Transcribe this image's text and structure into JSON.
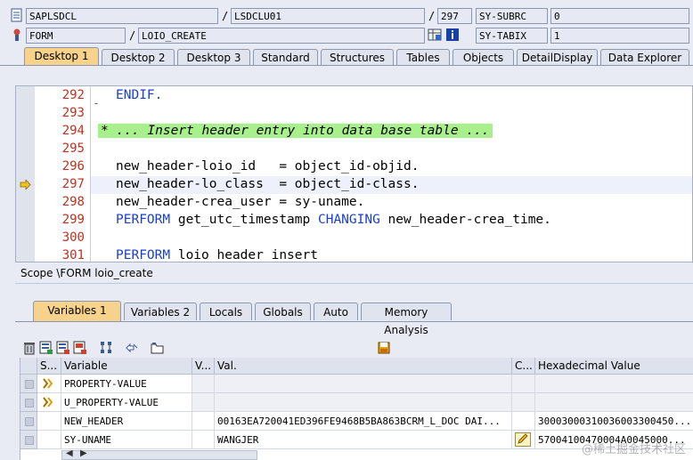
{
  "header": {
    "program": "SAPLSDCL",
    "include": "LSDCLU01",
    "line": "297",
    "sy_subrc_label": "SY-SUBRC",
    "sy_subrc_value": "0",
    "event_type": "FORM",
    "event_name": "LOIO_CREATE",
    "sy_tabix_label": "SY-TABIX",
    "sy_tabix_value": "1"
  },
  "desktop_tabs": [
    "Desktop 1",
    "Desktop 2",
    "Desktop 3",
    "Standard",
    "Structures",
    "Tables",
    "Objects",
    "DetailDisplay",
    "Data Explorer"
  ],
  "code_lines": [
    {
      "num": "292",
      "text": "ENDIF."
    },
    {
      "num": "293",
      "text": ""
    },
    {
      "num": "294",
      "text": "* ... Insert header entry into data base table ..."
    },
    {
      "num": "295",
      "text": ""
    },
    {
      "num": "296",
      "text": "new_header-loio_id   = object_id-objid."
    },
    {
      "num": "297",
      "text": "new_header-lo_class  = object_id-class."
    },
    {
      "num": "298",
      "text": "new_header-crea_user = sy-uname."
    },
    {
      "num": "299",
      "text": "get_utc_timestamp  new_header-crea_time."
    },
    {
      "num": "300",
      "text": ""
    },
    {
      "num": "301",
      "text": "loio header insert"
    }
  ],
  "code_keywords": {
    "perform": "PERFORM",
    "changing": "CHANGING"
  },
  "scope_text": "Scope \\FORM loio_create",
  "var_tabs": [
    "Variables 1",
    "Variables 2",
    "Locals",
    "Globals",
    "Auto",
    "Memory Analysis"
  ],
  "table": {
    "headers": [
      "S...",
      "Variable",
      "V...",
      "Val.",
      "C...",
      "Hexadecimal Value"
    ],
    "rows": [
      {
        "variable": "PROPERTY-VALUE",
        "value": "",
        "hex": ""
      },
      {
        "variable": "U_PROPERTY-VALUE",
        "value": "",
        "hex": ""
      },
      {
        "variable": "NEW_HEADER",
        "value": "00163EA720041ED396FE9468B5BA863BCRM_L_DOC  DAI...",
        "hex": "30003000310036003300450..."
      },
      {
        "variable": "SY-UNAME",
        "value": "WANGJER",
        "hex": "57004100470004A0045000..."
      }
    ]
  },
  "watermark": "@稀土掘金技术社区",
  "colors": {
    "active_tab": "#f7d28a",
    "keyword": "#1a3fd0",
    "line_number": "#c03020",
    "comment_bg": "#a8f08c"
  }
}
